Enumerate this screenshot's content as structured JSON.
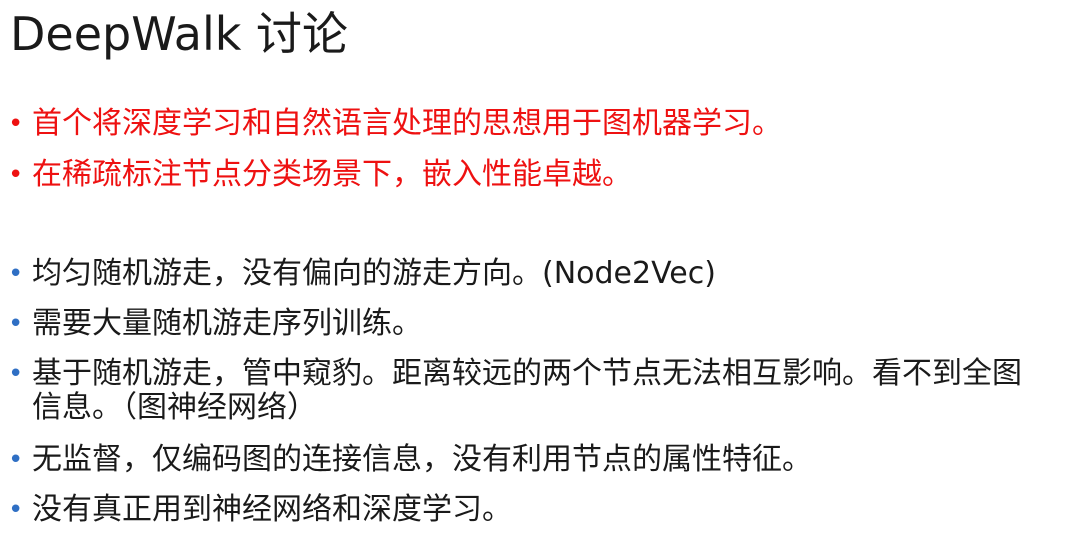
{
  "slide": {
    "title": "DeepWalk 讨论",
    "bullets": [
      {
        "text": "首个将深度学习和自然语言处理的思想用于图机器学习。",
        "color": "#ee1111",
        "bullet_color": "#ee1111"
      },
      {
        "text": "在稀疏标注节点分类场景下，嵌入性能卓越。",
        "color": "#ee1111",
        "bullet_color": "#ee1111"
      },
      {
        "text": "均匀随机游走，没有偏向的游走方向。(Node2Vec)",
        "color": "#1a1a1a",
        "bullet_color": "#2f6fc4"
      },
      {
        "text": "需要大量随机游走序列训练。",
        "color": "#1a1a1a",
        "bullet_color": "#2f6fc4"
      },
      {
        "text": "基于随机游走，管中窥豹。距离较远的两个节点无法相互影响。看不到全图信息。（图神经网络）",
        "color": "#1a1a1a",
        "bullet_color": "#2f6fc4"
      },
      {
        "text": "无监督，仅编码图的连接信息，没有利用节点的属性特征。",
        "color": "#1a1a1a",
        "bullet_color": "#2f6fc4"
      },
      {
        "text": "没有真正用到神经网络和深度学习。",
        "color": "#1a1a1a",
        "bullet_color": "#2f6fc4"
      }
    ]
  },
  "bullet_glyph": "•"
}
